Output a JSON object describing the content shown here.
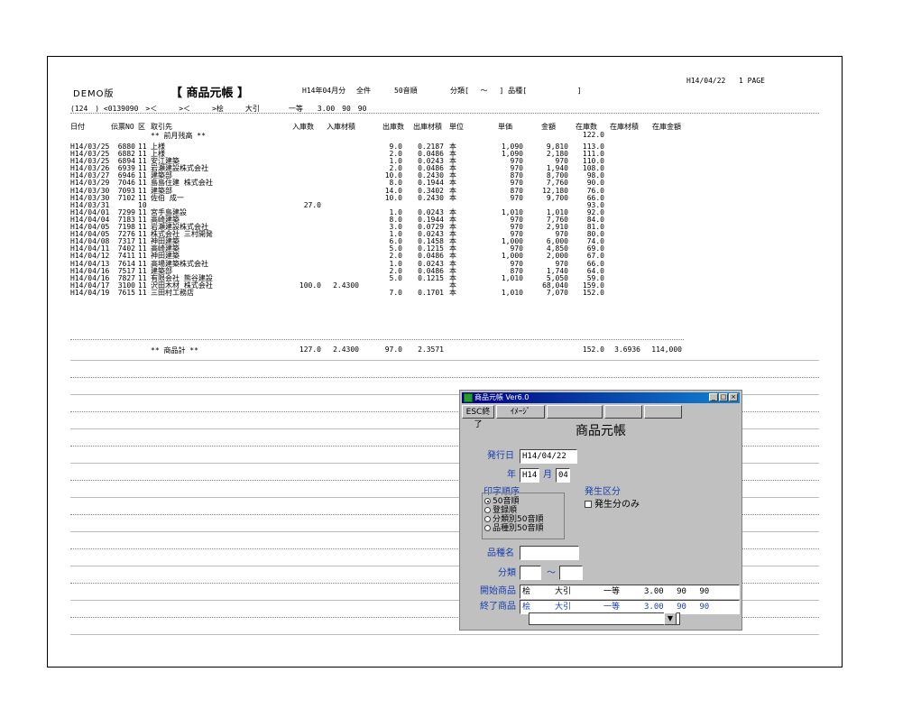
{
  "report": {
    "title_left": "DEMO版",
    "title_main": "【 商品元帳 】",
    "period": "H14年04月分",
    "scope": "全件",
    "order": "50音順",
    "category_filter": "分類[　 ～ 　] 品種[　　　　　　　]",
    "print_date": "H14/04/22",
    "page": "1 PAGE",
    "subheader": "(124　) <0139090　>＜　　　>＜　　　>桧　　　大引　　　　一等　　3.00　90　90",
    "columns": [
      "日付",
      "伝票NO",
      "区",
      "取引先",
      "入庫数",
      "入庫材積",
      "出庫数",
      "出庫材積",
      "単位",
      "単価",
      "金額",
      "在庫数",
      "在庫材積",
      "在庫金額"
    ],
    "opening": {
      "label": "** 前月残高 **",
      "stock": "122.0"
    },
    "rows": [
      {
        "date": "H14/03/25",
        "no": "6880",
        "k": "11",
        "party": "上様",
        "in_qty": "",
        "in_vol": "",
        "out_qty": "9.0",
        "out_vol": "0.2187",
        "unit": "本",
        "price": "1,090",
        "amount": "9,810",
        "stock": "113.0"
      },
      {
        "date": "H14/03/25",
        "no": "6882",
        "k": "11",
        "party": "上様",
        "in_qty": "",
        "in_vol": "",
        "out_qty": "2.0",
        "out_vol": "0.0486",
        "unit": "本",
        "price": "1,090",
        "amount": "2,180",
        "stock": "111.0"
      },
      {
        "date": "H14/03/25",
        "no": "6894",
        "k": "11",
        "party": "安江建築",
        "in_qty": "",
        "in_vol": "",
        "out_qty": "1.0",
        "out_vol": "0.0243",
        "unit": "本",
        "price": "970",
        "amount": "970",
        "stock": "110.0"
      },
      {
        "date": "H14/03/26",
        "no": "6939",
        "k": "11",
        "party": "岩瀬建設株式会社",
        "in_qty": "",
        "in_vol": "",
        "out_qty": "2.0",
        "out_vol": "0.0486",
        "unit": "本",
        "price": "970",
        "amount": "1,940",
        "stock": "108.0"
      },
      {
        "date": "H14/03/27",
        "no": "6946",
        "k": "11",
        "party": "建築部",
        "in_qty": "",
        "in_vol": "",
        "out_qty": "10.0",
        "out_vol": "0.2430",
        "unit": "本",
        "price": "870",
        "amount": "8,700",
        "stock": "98.0"
      },
      {
        "date": "H14/03/29",
        "no": "7046",
        "k": "11",
        "party": "島島住建 株式会社",
        "in_qty": "",
        "in_vol": "",
        "out_qty": "8.0",
        "out_vol": "0.1944",
        "unit": "本",
        "price": "970",
        "amount": "7,760",
        "stock": "90.0"
      },
      {
        "date": "H14/03/30",
        "no": "7093",
        "k": "11",
        "party": "建築部",
        "in_qty": "",
        "in_vol": "",
        "out_qty": "14.0",
        "out_vol": "0.3402",
        "unit": "本",
        "price": "870",
        "amount": "12,180",
        "stock": "76.0"
      },
      {
        "date": "H14/03/30",
        "no": "7102",
        "k": "11",
        "party": "佐伯 成一",
        "in_qty": "",
        "in_vol": "",
        "out_qty": "10.0",
        "out_vol": "0.2430",
        "unit": "本",
        "price": "970",
        "amount": "9,700",
        "stock": "66.0"
      },
      {
        "date": "H14/03/31",
        "no": "",
        "k": "10",
        "party": "",
        "in_qty": "27.0",
        "in_vol": "",
        "out_qty": "",
        "out_vol": "",
        "unit": "",
        "price": "",
        "amount": "",
        "stock": "93.0"
      },
      {
        "date": "H14/04/01",
        "no": "7299",
        "k": "11",
        "party": "宮手島建設",
        "in_qty": "",
        "in_vol": "",
        "out_qty": "1.0",
        "out_vol": "0.0243",
        "unit": "本",
        "price": "1,010",
        "amount": "1,010",
        "stock": "92.0"
      },
      {
        "date": "H14/04/04",
        "no": "7183",
        "k": "11",
        "party": "高崎建築",
        "in_qty": "",
        "in_vol": "",
        "out_qty": "8.0",
        "out_vol": "0.1944",
        "unit": "本",
        "price": "970",
        "amount": "7,760",
        "stock": "84.0"
      },
      {
        "date": "H14/04/05",
        "no": "7198",
        "k": "11",
        "party": "岩瀬建設株式会社",
        "in_qty": "",
        "in_vol": "",
        "out_qty": "3.0",
        "out_vol": "0.0729",
        "unit": "本",
        "price": "970",
        "amount": "2,910",
        "stock": "81.0"
      },
      {
        "date": "H14/04/05",
        "no": "7276",
        "k": "11",
        "party": "株式会社 三村開発",
        "in_qty": "",
        "in_vol": "",
        "out_qty": "1.0",
        "out_vol": "0.0243",
        "unit": "本",
        "price": "970",
        "amount": "970",
        "stock": "80.0"
      },
      {
        "date": "H14/04/08",
        "no": "7317",
        "k": "11",
        "party": "神田建築",
        "in_qty": "",
        "in_vol": "",
        "out_qty": "6.0",
        "out_vol": "0.1458",
        "unit": "本",
        "price": "1,000",
        "amount": "6,000",
        "stock": "74.0"
      },
      {
        "date": "H14/04/11",
        "no": "7402",
        "k": "11",
        "party": "高崎建築",
        "in_qty": "",
        "in_vol": "",
        "out_qty": "5.0",
        "out_vol": "0.1215",
        "unit": "本",
        "price": "970",
        "amount": "4,850",
        "stock": "69.0"
      },
      {
        "date": "H14/04/12",
        "no": "7411",
        "k": "11",
        "party": "神田建築",
        "in_qty": "",
        "in_vol": "",
        "out_qty": "2.0",
        "out_vol": "0.0486",
        "unit": "本",
        "price": "1,000",
        "amount": "2,000",
        "stock": "67.0"
      },
      {
        "date": "H14/04/13",
        "no": "7614",
        "k": "11",
        "party": "高場建築株式会社",
        "in_qty": "",
        "in_vol": "",
        "out_qty": "1.0",
        "out_vol": "0.0243",
        "unit": "本",
        "price": "970",
        "amount": "970",
        "stock": "66.0"
      },
      {
        "date": "H14/04/16",
        "no": "7517",
        "k": "11",
        "party": "建築部",
        "in_qty": "",
        "in_vol": "",
        "out_qty": "2.0",
        "out_vol": "0.0486",
        "unit": "本",
        "price": "870",
        "amount": "1,740",
        "stock": "64.0"
      },
      {
        "date": "H14/04/16",
        "no": "7827",
        "k": "11",
        "party": "有限会社 熊谷建設",
        "in_qty": "",
        "in_vol": "",
        "out_qty": "5.0",
        "out_vol": "0.1215",
        "unit": "本",
        "price": "1,010",
        "amount": "5,050",
        "stock": "59.0"
      },
      {
        "date": "H14/04/17",
        "no": "3100",
        "k": "11",
        "party": "沢田木材 株式会社",
        "in_qty": "100.0",
        "in_vol": "2.4300",
        "out_qty": "",
        "out_vol": "",
        "unit": "本",
        "price": "",
        "amount": "68,040",
        "stock": "159.0"
      },
      {
        "date": "H14/04/19",
        "no": "7615",
        "k": "11",
        "party": "三田村工務店",
        "in_qty": "",
        "in_vol": "",
        "out_qty": "7.0",
        "out_vol": "0.1701",
        "unit": "本",
        "price": "1,010",
        "amount": "7,070",
        "stock": "152.0"
      }
    ],
    "total": {
      "label": "** 商品計 **",
      "in_qty": "127.0",
      "in_vol": "2.4300",
      "out_qty": "97.0",
      "out_vol": "2.3571",
      "stock": "152.0",
      "stock_vol": "3.6936",
      "stock_amt": "114,000"
    }
  },
  "dialog": {
    "title": "商品元帳 Ver6.0",
    "esc_button": "ESC終了",
    "image_button": "ｲﾒｰｼﾞ",
    "heading": "商品元帳",
    "issue_date_label": "発行日",
    "issue_date_value": "H14/04/22",
    "year_label": "年",
    "year_value": "H14",
    "month_label": "月",
    "month_value": "04",
    "print_order_label": "印字順序",
    "order_options": [
      "50音順",
      "登録順",
      "分類別50音順",
      "品種別50音順"
    ],
    "occurrence_label": "発生区分",
    "occurrence_only": "発生分のみ",
    "variety_label": "品種名",
    "variety_value": "",
    "category_label": "分類",
    "category_from": "",
    "category_to": "",
    "tilde": "～",
    "start_label": "開始商品",
    "start_value": "桧　　　大引　　　　一等　　　3.00　 90　 90",
    "end_label": "終了商品",
    "end_value": "桧　　　大引　　　　一等　　　3.00　 90　 90"
  }
}
